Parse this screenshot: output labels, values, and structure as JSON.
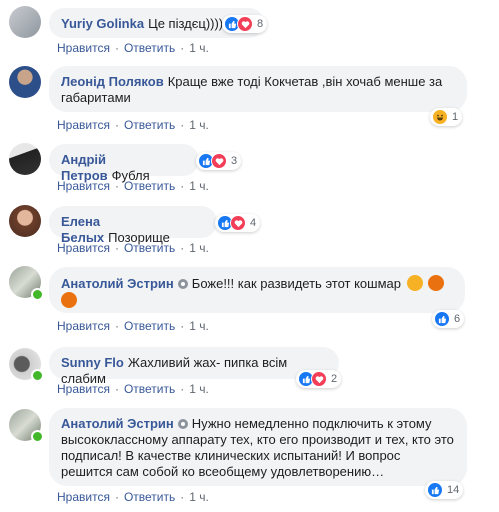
{
  "actions": {
    "like": "Нравится",
    "reply": "Ответить",
    "time": "1 ч."
  },
  "colors": {
    "author": "#385898",
    "bubble": "#f2f3f5",
    "like": "#1877f2",
    "love": "#f33e58",
    "haha": "#f7b125",
    "angry": "#e9710f",
    "online": "#42b72a"
  },
  "comments": [
    {
      "author": "Yuriy Golinka",
      "text": "Це піздєц))))",
      "reactions": [
        "like-icon",
        "love-icon"
      ],
      "count": "8"
    },
    {
      "author": "Леонід Поляков",
      "text": "Краще вже тоді Кокчетав ,він хочаб менше за габаритами",
      "reactions": [
        "haha-icon"
      ],
      "count": "1"
    },
    {
      "author": "Андрій Петров",
      "text": "Фубля",
      "reactions": [
        "like-icon",
        "love-icon"
      ],
      "count": "3"
    },
    {
      "author": "Елена Белых",
      "text": "Позорище",
      "reactions": [
        "like-icon",
        "love-icon"
      ],
      "count": "4"
    },
    {
      "author": "Анатолий Эстрин",
      "text": "Боже!!! как развидеть этот кошмар",
      "reactions": [
        "like-icon"
      ],
      "count": "6"
    },
    {
      "author": "Sunny Flo",
      "text": "Жахливий жах- пипка всім слабим",
      "reactions": [
        "like-icon",
        "love-icon"
      ],
      "count": "2"
    },
    {
      "author": "Анатолий Эстрин",
      "text": "Нужно немедленно подключить к этому высококлассному аппарату тех, кто его производит и тех, кто это подписал! В качестве клинических испытаний! И вопрос решится сам собой ко всеобщему удовлетворению…",
      "reactions": [
        "like-icon"
      ],
      "count": "14"
    }
  ]
}
